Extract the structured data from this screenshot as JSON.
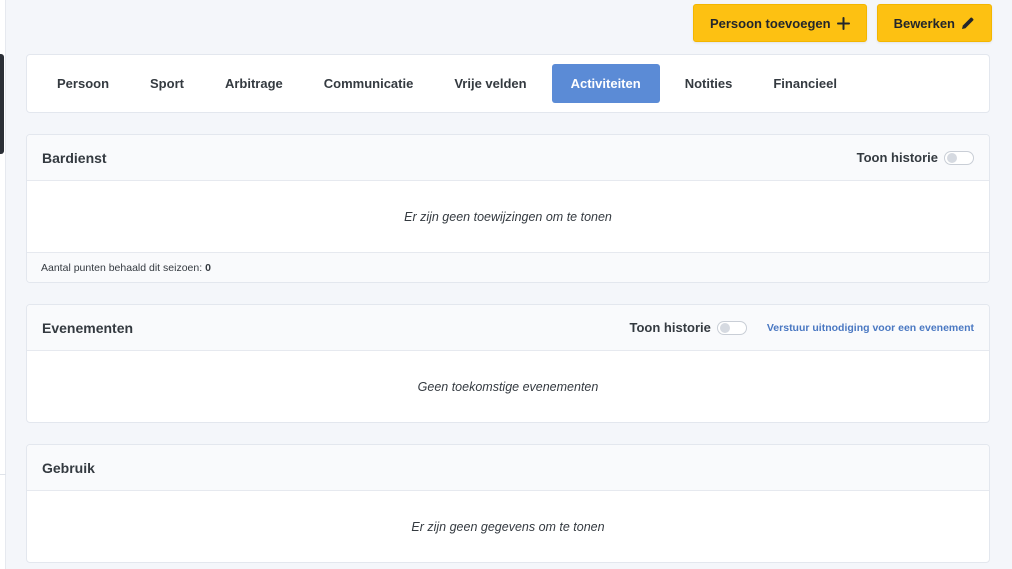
{
  "actions": {
    "add_person_label": "Persoon toevoegen",
    "edit_label": "Bewerken"
  },
  "tabs": [
    {
      "label": "Persoon",
      "active": false
    },
    {
      "label": "Sport",
      "active": false
    },
    {
      "label": "Arbitrage",
      "active": false
    },
    {
      "label": "Communicatie",
      "active": false
    },
    {
      "label": "Vrije velden",
      "active": false
    },
    {
      "label": "Activiteiten",
      "active": true
    },
    {
      "label": "Notities",
      "active": false
    },
    {
      "label": "Financieel",
      "active": false
    }
  ],
  "bardienst": {
    "title": "Bardienst",
    "history_label": "Toon historie",
    "history_on": false,
    "empty_text": "Er zijn geen toewijzingen om te tonen",
    "points_label": "Aantal punten behaald dit seizoen:",
    "points_value": "0"
  },
  "evenementen": {
    "title": "Evenementen",
    "history_label": "Toon historie",
    "history_on": false,
    "invite_link": "Verstuur uitnodiging voor een evenement",
    "empty_text": "Geen toekomstige evenementen"
  },
  "gebruik": {
    "title": "Gebruik",
    "empty_text": "Er zijn geen gegevens om te tonen"
  },
  "colors": {
    "accent_yellow": "#fdc112",
    "active_tab": "#5b8bd6",
    "link": "#4a78c2"
  },
  "icons": {
    "add": "plus-icon",
    "edit": "pencil-icon"
  }
}
